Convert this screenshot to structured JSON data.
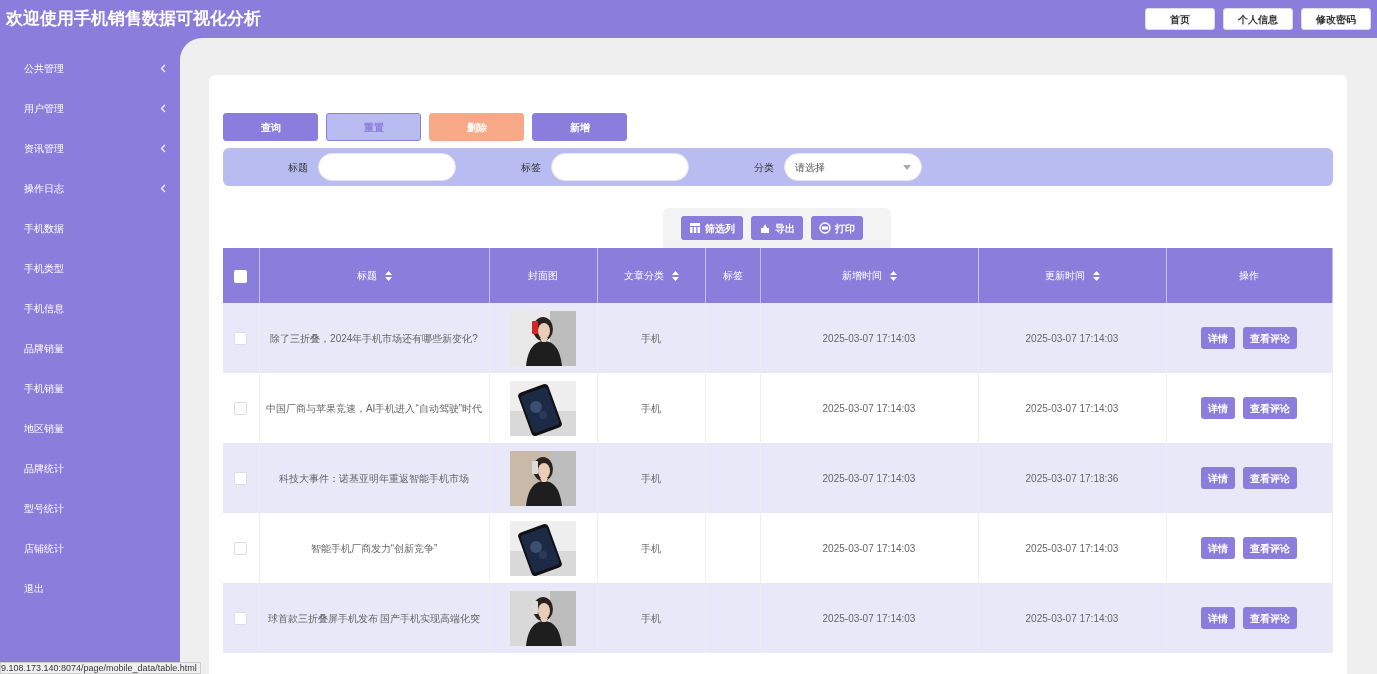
{
  "header": {
    "title": "欢迎使用手机销售数据可视化分析",
    "buttons": [
      "首页",
      "个人信息",
      "修改密码"
    ]
  },
  "sidebar": {
    "items": [
      {
        "label": "公共管理",
        "has_submenu": true
      },
      {
        "label": "用户管理",
        "has_submenu": true
      },
      {
        "label": "资讯管理",
        "has_submenu": true
      },
      {
        "label": "操作日志",
        "has_submenu": true
      },
      {
        "label": "手机数据",
        "has_submenu": false
      },
      {
        "label": "手机类型",
        "has_submenu": false
      },
      {
        "label": "手机信息",
        "has_submenu": false
      },
      {
        "label": "品牌销量",
        "has_submenu": false
      },
      {
        "label": "手机销量",
        "has_submenu": false
      },
      {
        "label": "地区销量",
        "has_submenu": false
      },
      {
        "label": "品牌统计",
        "has_submenu": false
      },
      {
        "label": "型号统计",
        "has_submenu": false
      },
      {
        "label": "店铺统计",
        "has_submenu": false
      },
      {
        "label": "退出",
        "has_submenu": false
      }
    ]
  },
  "actions": [
    {
      "label": "查询",
      "kind": "primary"
    },
    {
      "label": "重置",
      "kind": "light"
    },
    {
      "label": "删除",
      "kind": "danger"
    },
    {
      "label": "新增",
      "kind": "primary"
    }
  ],
  "filters": [
    {
      "label": "标题",
      "kind": "text"
    },
    {
      "label": "标签",
      "kind": "text"
    },
    {
      "label": "分类",
      "kind": "select",
      "placeholder": "请选择"
    }
  ],
  "tools": [
    {
      "label": "筛选列",
      "kind": "columns"
    },
    {
      "label": "导出",
      "kind": "export"
    },
    {
      "label": "打印",
      "kind": "print"
    }
  ],
  "table": {
    "select_all": {
      "checked": false
    },
    "columns": [
      {
        "label": "标题",
        "sortable": true
      },
      {
        "label": "封面图",
        "sortable": false
      },
      {
        "label": "文章分类",
        "sortable": true
      },
      {
        "label": "标签",
        "sortable": false
      },
      {
        "label": "新增时间",
        "sortable": true
      },
      {
        "label": "更新时间",
        "sortable": true
      },
      {
        "label": "操作",
        "sortable": false
      }
    ],
    "rows": [
      {
        "checked": false,
        "title": "除了三折叠，2024年手机市场还有哪些新变化?",
        "cover": {
          "kind": "figure"
        },
        "category": "手机",
        "created": "2025-03-07 17:14:03",
        "updated": "2025-03-07 17:14:03",
        "actions": [
          "详情",
          "查看评论"
        ]
      },
      {
        "checked": false,
        "title": "中国厂商与苹果竞速，AI手机进入“自动驾驶”时代",
        "cover": {
          "kind": "phone"
        },
        "category": "手机",
        "created": "2025-03-07 17:14:03",
        "updated": "2025-03-07 17:14:03",
        "actions": [
          "详情",
          "查看评论"
        ]
      },
      {
        "checked": false,
        "title": "科技大事件：诺基亚明年重返智能手机市场",
        "cover": {
          "kind": "figure"
        },
        "category": "手机",
        "created": "2025-03-07 17:14:03",
        "updated": "2025-03-07 17:18:36",
        "actions": [
          "详情",
          "查看评论"
        ]
      },
      {
        "checked": false,
        "title": "智能手机厂商发力“创新竞争”",
        "cover": {
          "kind": "phone"
        },
        "category": "手机",
        "created": "2025-03-07 17:14:03",
        "updated": "2025-03-07 17:14:03",
        "actions": [
          "详情",
          "查看评论"
        ]
      },
      {
        "checked": false,
        "title": "球首款三折叠屏手机发布 国产手机实现高端化突",
        "cover": {
          "kind": "figure"
        },
        "category": "手机",
        "created": "2025-03-07 17:14:03",
        "updated": "2025-03-07 17:14:03",
        "actions": [
          "详情",
          "查看评论"
        ]
      }
    ]
  },
  "status_url": "9.108.173.140:8074/page/mobile_data/table.html"
}
